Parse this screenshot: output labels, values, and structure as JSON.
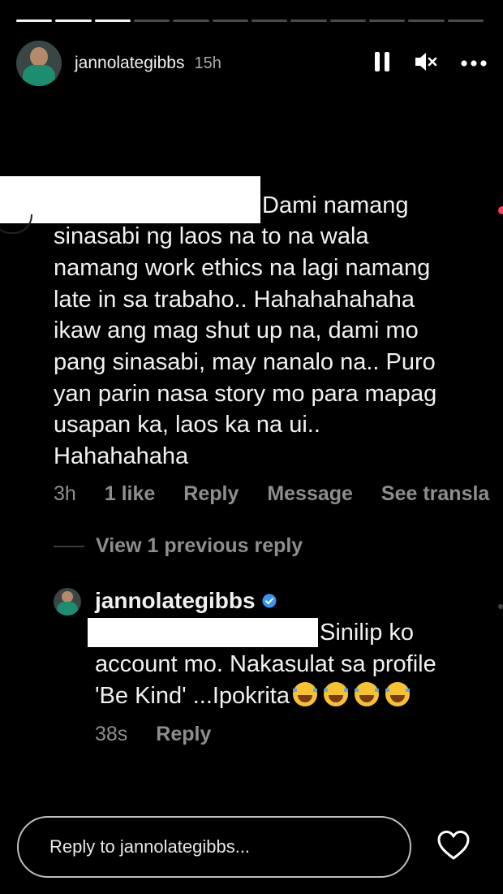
{
  "story": {
    "segments_total": 12,
    "segments_done": 3,
    "username": "jannolategibbs",
    "time": "15h"
  },
  "controls": {
    "pause_icon": "pause-icon",
    "mute_icon": "muted-speaker-icon",
    "more_icon": "more-horizontal-icon"
  },
  "comment": {
    "text_lines": [
      "Dami namang",
      "sinasabi ng laos na to na wala",
      "namang work ethics na lagi namang",
      "late in sa trabaho.. Hahahahahaha",
      "ikaw ang mag shut up na, dami mo",
      "pang sinasabi, may nanalo na.. Puro",
      "yan parin nasa story mo para mapag",
      "usapan ka, laos ka na ui..",
      "Hahahahaha"
    ],
    "time": "3h",
    "likes": "1 like",
    "reply": "Reply",
    "message": "Message",
    "see_translation": "See transla"
  },
  "view_previous": "View 1 previous reply",
  "reply": {
    "username": "jannolategibbs",
    "text_lines": [
      "Sinilip ko",
      "account mo. Nakasulat sa profile",
      "'Be Kind' ...Ipokrita"
    ],
    "emoji": [
      "😂",
      "😂",
      "😂",
      "😂"
    ],
    "time": "38s",
    "reply_label": "Reply"
  },
  "reply_input": {
    "placeholder": "Reply to jannolategibbs..."
  },
  "colors": {
    "background": "#000000",
    "text": "#f1f1f1",
    "meta": "#8e8e8e",
    "verified": "#3897f0",
    "story_accent": "#ff3b5c"
  }
}
